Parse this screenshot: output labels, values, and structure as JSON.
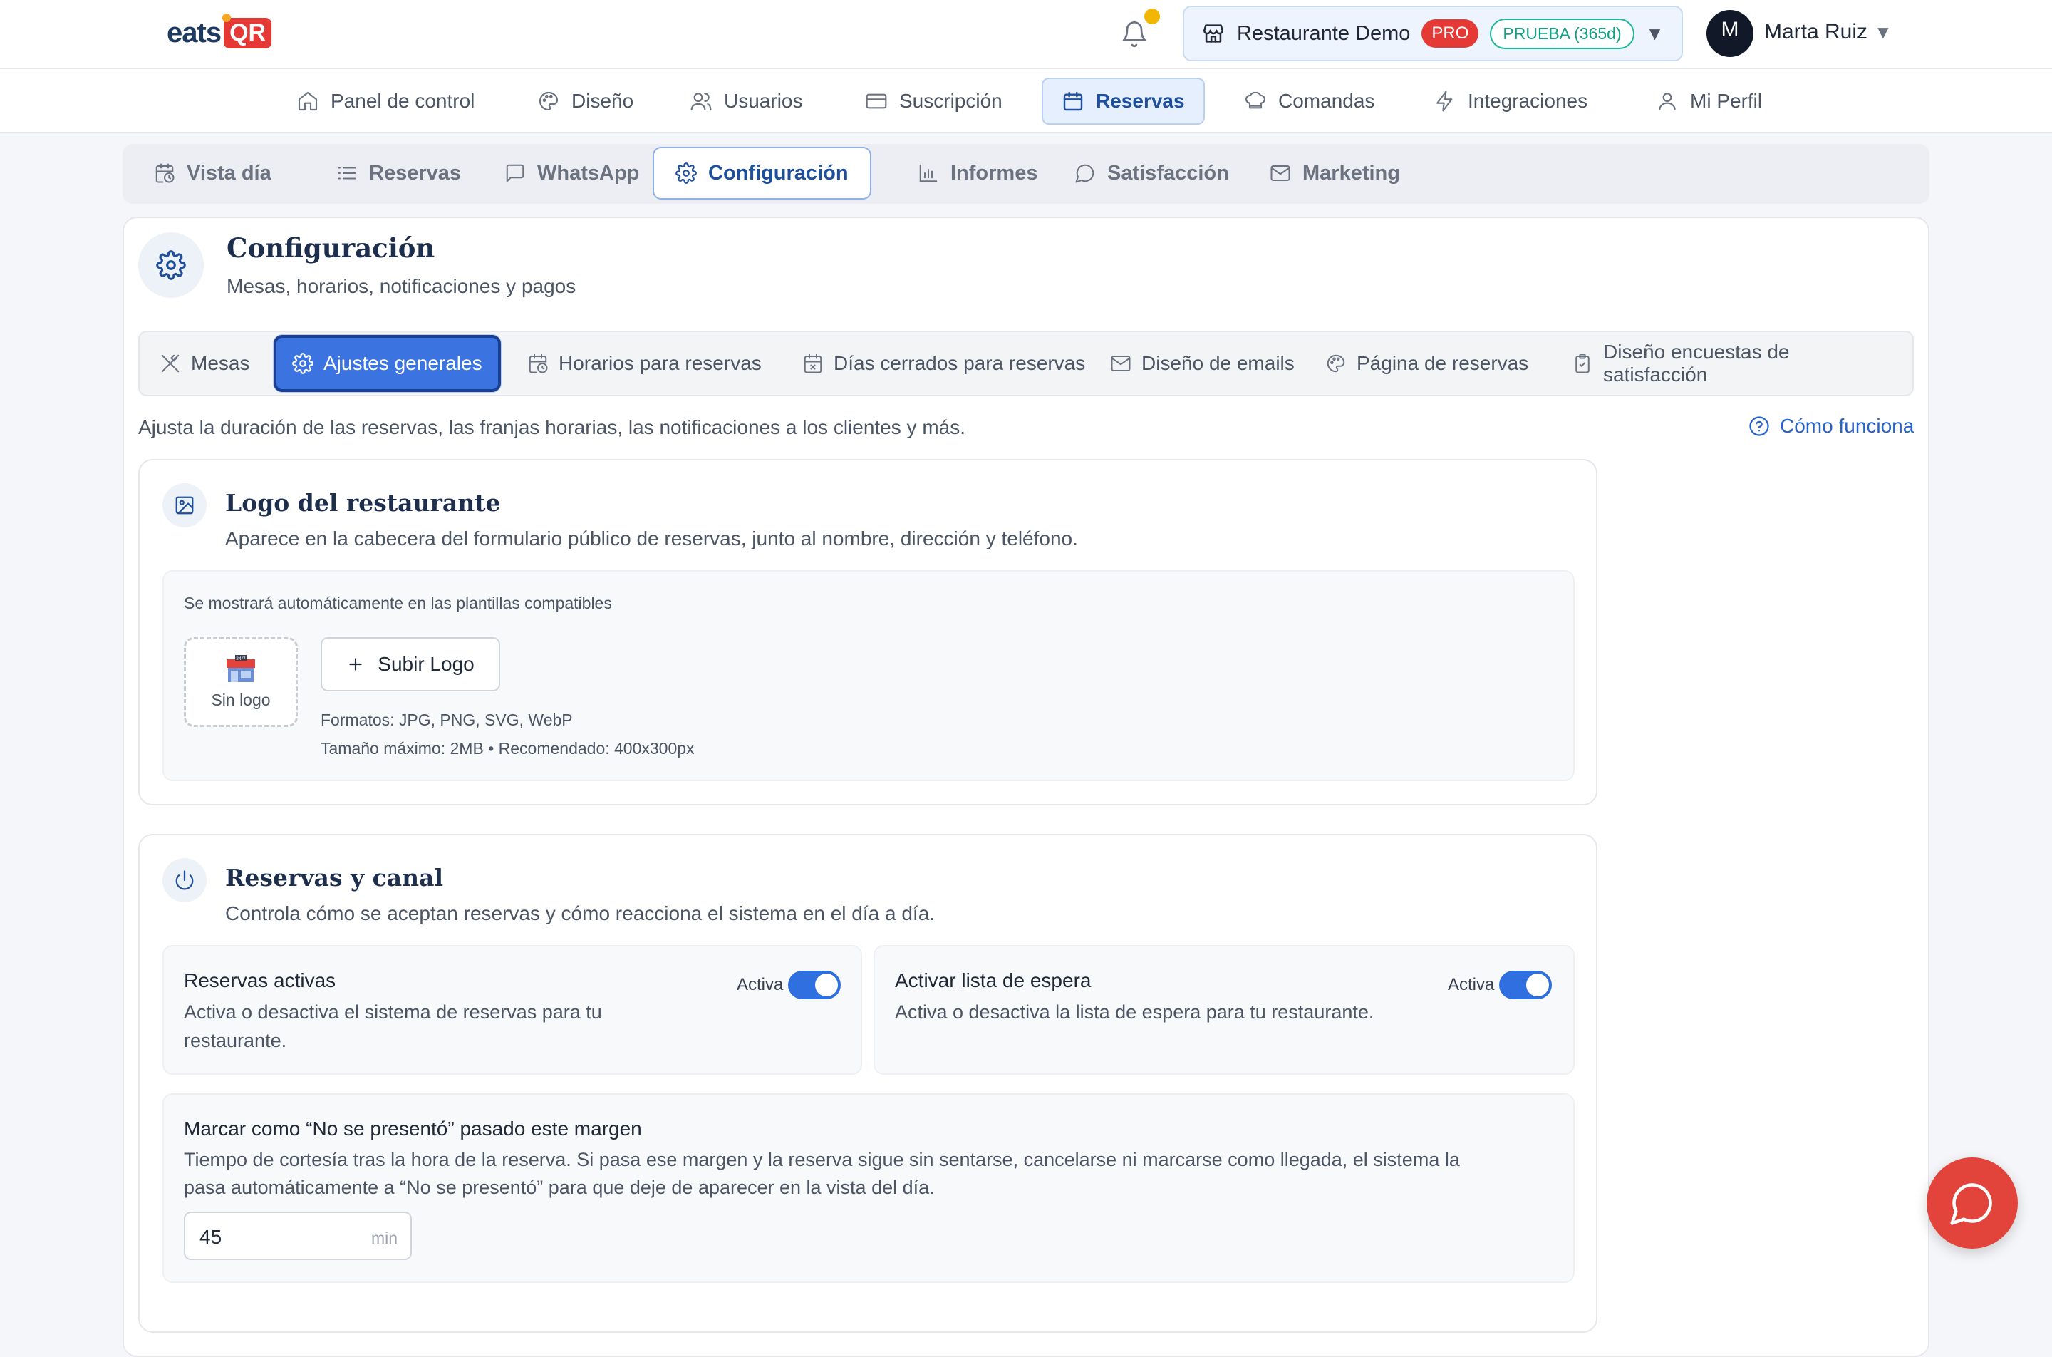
{
  "brand": {
    "word": "eats",
    "badge": "QR"
  },
  "header": {
    "restaurant": {
      "name": "Restaurante Demo",
      "plan": "PRO",
      "trial": "PRUEBA (365d)"
    },
    "user": {
      "initial": "M",
      "name": "Marta Ruiz"
    }
  },
  "main_nav": [
    {
      "label": "Panel de control",
      "icon": "home-icon"
    },
    {
      "label": "Diseño",
      "icon": "palette-icon"
    },
    {
      "label": "Usuarios",
      "icon": "users-icon"
    },
    {
      "label": "Suscripción",
      "icon": "credit-card-icon"
    },
    {
      "label": "Reservas",
      "icon": "calendar-icon",
      "active": true
    },
    {
      "label": "Comandas",
      "icon": "chef-hat-icon"
    },
    {
      "label": "Integraciones",
      "icon": "lightning-icon"
    },
    {
      "label": "Mi Perfil",
      "icon": "user-icon"
    }
  ],
  "sub_tabs": [
    {
      "label": "Vista día",
      "icon": "calendar-clock-icon"
    },
    {
      "label": "Reservas",
      "icon": "list-icon"
    },
    {
      "label": "WhatsApp",
      "icon": "message-square-icon"
    },
    {
      "label": "Configuración",
      "icon": "gear-icon",
      "active": true
    },
    {
      "label": "Informes",
      "icon": "bar-chart-icon"
    },
    {
      "label": "Satisfacción",
      "icon": "chat-bubble-icon"
    },
    {
      "label": "Marketing",
      "icon": "mail-icon"
    }
  ],
  "page": {
    "title": "Configuración",
    "subtitle": "Mesas, horarios, notificaciones y pagos"
  },
  "settings_tabs": [
    {
      "label": "Mesas",
      "icon": "utensils-icon"
    },
    {
      "label": "Ajustes generales",
      "icon": "gear-icon",
      "active": true
    },
    {
      "label": "Horarios para reservas",
      "icon": "calendar-clock-icon"
    },
    {
      "label": "Días cerrados para reservas",
      "icon": "calendar-x-icon"
    },
    {
      "label": "Diseño de emails",
      "icon": "mail-icon"
    },
    {
      "label": "Página de reservas",
      "icon": "palette-icon"
    },
    {
      "label": "Diseño encuestas de satisfacción",
      "icon": "clipboard-icon"
    }
  ],
  "description": "Ajusta la duración de las reservas, las franjas horarias, las notificaciones a los clientes y más.",
  "help_link": "Cómo funciona",
  "logo_section": {
    "title": "Logo del restaurante",
    "subtitle": "Aparece en la cabecera del formulario público de reservas, junto al nombre, dirección y teléfono.",
    "note": "Se mostrará automáticamente en las plantillas compatibles",
    "placeholder": "Sin logo",
    "upload_label": "Subir Logo",
    "formats": "Formatos: JPG, PNG, SVG, WebP",
    "max_size": "Tamaño máximo: 2MB • Recomendado: 400x300px"
  },
  "booking_section": {
    "title": "Reservas y canal",
    "subtitle": "Controla cómo se aceptan reservas y cómo reacciona el sistema en el día a día.",
    "toggles": [
      {
        "title": "Reservas activas",
        "desc_line1": "Activa o desactiva el sistema de reservas para tu",
        "desc_line2": "restaurante.",
        "state_label": "Activa",
        "on": true
      },
      {
        "title": "Activar lista de espera",
        "desc_line1": "Activa o desactiva la lista de espera para tu restaurante.",
        "desc_line2": "",
        "state_label": "Activa",
        "on": true
      }
    ],
    "no_show": {
      "title": "Marcar como “No se presentó” pasado este margen",
      "desc_line1": "Tiempo de cortesía tras la hora de la reserva. Si pasa ese margen y la reserva sigue sin sentarse, cancelarse ni marcarse como llegada, el sistema la",
      "desc_line2": "pasa automáticamente a “No se presentó” para que deje de aparecer en la vista del día.",
      "value": "45",
      "unit": "min"
    }
  },
  "colors": {
    "primary": "#3b73e0",
    "brand_red": "#e53935",
    "trial_green": "#14a085",
    "title_navy": "#1e2f4d"
  }
}
